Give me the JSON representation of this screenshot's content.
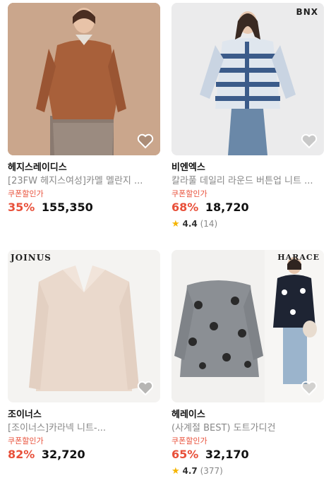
{
  "products": [
    {
      "brand": "헤지스레이디스",
      "title": "[23FW 헤지스여성]카멜 멜란지 ...",
      "coupon_label": "쿠폰할인가",
      "discount": "35%",
      "price": "155,350",
      "image": "brown-cardigan-model"
    },
    {
      "brand": "비엔엑스",
      "title": "칼라풀 데일리 라운드 버튼업 니트 ...",
      "coupon_label": "쿠폰할인가",
      "discount": "68%",
      "price": "18,720",
      "rating": "4.4",
      "review_count": "(14)",
      "logo_text": "BNX",
      "image": "striped-cardigan-model"
    },
    {
      "brand": "조이너스",
      "title": "[조이너스]카라넥 니트-...",
      "coupon_label": "쿠폰할인가",
      "discount": "82%",
      "price": "32,720",
      "logo_text": "JOINUS",
      "image": "beige-collar-knit"
    },
    {
      "brand": "헤레이스",
      "title": "(사계절 BEST) 도트가디건",
      "coupon_label": "쿠폰할인가",
      "discount": "65%",
      "price": "32,170",
      "rating": "4.7",
      "review_count": "(377)",
      "logo_text": "HARACE",
      "image": "gray-dot-cardigan"
    }
  ],
  "colors": {
    "discount": "#e8503a",
    "star": "#f5b400",
    "muted": "#888888"
  },
  "icons": {
    "wishlist": "heart-outline-icon",
    "rating": "star-icon"
  }
}
